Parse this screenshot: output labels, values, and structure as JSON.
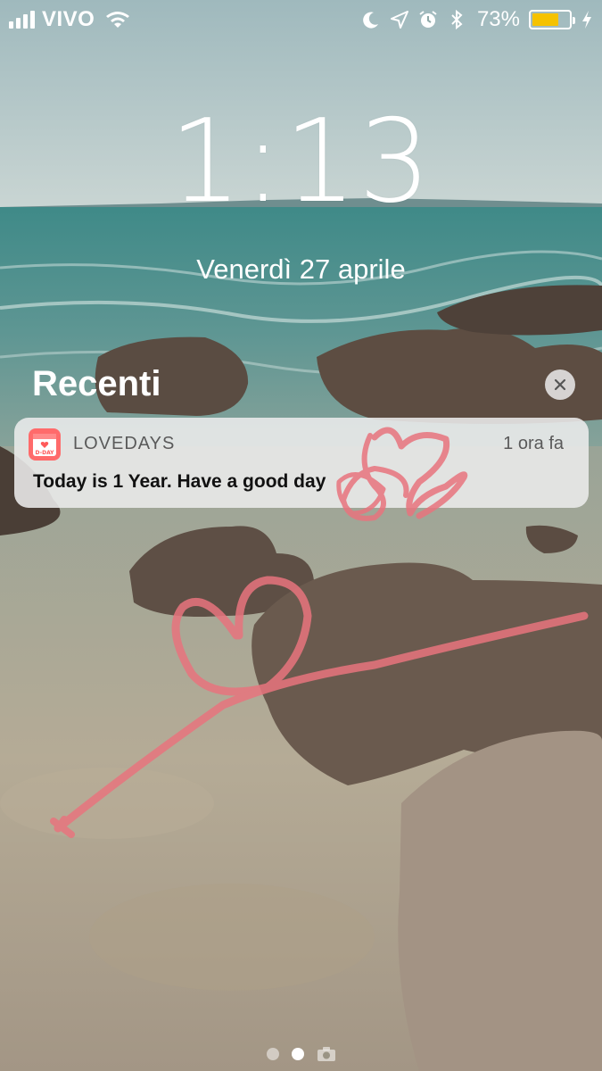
{
  "status_bar": {
    "carrier": "VIVO",
    "battery_percent": "73%",
    "battery_level": 0.73,
    "icons": [
      "signal-icon",
      "wifi-icon",
      "moon-icon",
      "location-icon",
      "alarm-icon",
      "bluetooth-icon",
      "battery-icon",
      "charging-icon"
    ]
  },
  "lock_screen": {
    "time": "1:13",
    "date": "Venerdì 27 aprile"
  },
  "notifications": {
    "section_title": "Recenti",
    "items": [
      {
        "app_name": "LOVEDAYS",
        "app_icon_text": "D-DAY",
        "time": "1 ora fa",
        "message": "Today is 1 Year. Have a good day"
      }
    ]
  },
  "page_indicator": {
    "pages": 2,
    "active_index": 1,
    "icons": [
      "camera-icon"
    ]
  },
  "colors": {
    "battery_fill": "#f5c200",
    "doodle_pink": "#e8747e",
    "app_icon_red": "#ff6b6b"
  }
}
